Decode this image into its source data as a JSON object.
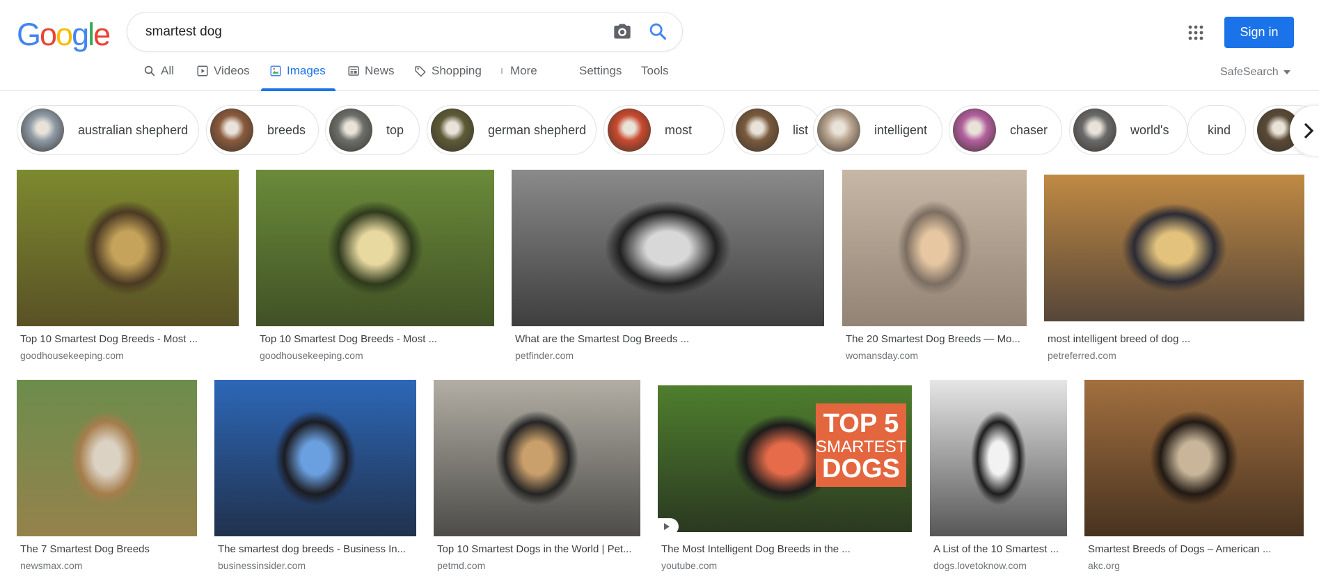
{
  "logo": {
    "letters": [
      "G",
      "o",
      "o",
      "g",
      "l",
      "e"
    ],
    "colors": [
      "#4285f4",
      "#ea4335",
      "#fbbc05",
      "#4285f4",
      "#34a853",
      "#ea4335"
    ]
  },
  "search": {
    "query": "smartest dog"
  },
  "header": {
    "sign_in": "Sign in",
    "apps_icon": "apps-grid-icon"
  },
  "tabs": [
    {
      "label": "All",
      "icon": "search-icon",
      "active": false
    },
    {
      "label": "Videos",
      "icon": "video-icon",
      "active": false
    },
    {
      "label": "Images",
      "icon": "image-icon",
      "active": true
    },
    {
      "label": "News",
      "icon": "news-icon",
      "active": false
    },
    {
      "label": "Shopping",
      "icon": "tag-icon",
      "active": false
    },
    {
      "label": "More",
      "icon": "more-vert-icon",
      "active": false
    },
    {
      "label": "Settings",
      "active": false
    },
    {
      "label": "Tools",
      "active": false
    }
  ],
  "safesearch": {
    "label": "SafeSearch"
  },
  "chips": [
    {
      "label": "australian shepherd",
      "color": "#8d9aa6"
    },
    {
      "label": "breeds",
      "color": "#8a5a3c"
    },
    {
      "label": "top",
      "color": "#6d6f6a"
    },
    {
      "label": "german shepherd",
      "color": "#5d5a36"
    },
    {
      "label": "most",
      "color": "#c94a2f"
    },
    {
      "label": "list",
      "color": "#7a5a3d"
    },
    {
      "label": "intelligent",
      "color": "#b9a48f"
    },
    {
      "label": "chaser",
      "color": "#b35f9e"
    },
    {
      "label": "world's",
      "color": "#6a6a6a"
    },
    {
      "label": "kind",
      "color": null
    },
    {
      "label": "",
      "color": "#5a4a36"
    }
  ],
  "results_row1": [
    {
      "title": "Top 10 Smartest Dog Breeds - Most ...",
      "source": "goodhousekeeping.com",
      "colors": [
        "#7d8a2e",
        "#4b3a23",
        "#c5a35a"
      ]
    },
    {
      "title": "Top 10 Smartest Dog Breeds - Most ...",
      "source": "goodhousekeeping.com",
      "colors": [
        "#6b8b3a",
        "#2f3a1d",
        "#e8d9a0"
      ]
    },
    {
      "title": "What are the Smartest Dog Breeds ...",
      "source": "petfinder.com",
      "colors": [
        "#8a8a8a",
        "#202020",
        "#d8d8d8"
      ]
    },
    {
      "title": "The 20 Smartest Dog Breeds — Mo...",
      "source": "womansday.com",
      "colors": [
        "#c7b7a5",
        "#7c6e62",
        "#e6c7a2"
      ]
    },
    {
      "title": "most intelligent breed of dog ...",
      "source": "petreferred.com",
      "colors": [
        "#c08a43",
        "#2b2b35",
        "#e3c27d"
      ]
    }
  ],
  "results_row2": [
    {
      "title": "The 7 Smartest Dog Breeds",
      "source": "newsmax.com",
      "colors": [
        "#6c8d4c",
        "#a57d4b",
        "#dcd2c4"
      ]
    },
    {
      "title": "The smartest dog breeds - Business In...",
      "source": "businessinsider.com",
      "colors": [
        "#2d67b8",
        "#1c1c22",
        "#6aa0e0"
      ]
    },
    {
      "title": "Top 10 Smartest Dogs in the World | Pet...",
      "source": "petmd.com",
      "colors": [
        "#b2aea4",
        "#252525",
        "#c99f6b"
      ]
    },
    {
      "title": "The Most Intelligent Dog Breeds in the ...",
      "source": "youtube.com",
      "colors": [
        "#4f7f2e",
        "#1c1c1c",
        "#e56b4a"
      ]
    },
    {
      "title": "A List of the 10 Smartest ...",
      "source": "dogs.lovetoknow.com",
      "colors": [
        "#e6e6e6",
        "#1e1e1e",
        "#f2f2f2"
      ]
    },
    {
      "title": "Smartest Breeds of Dogs – American ...",
      "source": "akc.org",
      "colors": [
        "#a3703f",
        "#221a14",
        "#c9b69a"
      ]
    }
  ],
  "thumbnail_overlays": {
    "top5_line1": "TOP 5",
    "top5_line2": "SMARTEST",
    "top5_line3": "DOGS"
  }
}
